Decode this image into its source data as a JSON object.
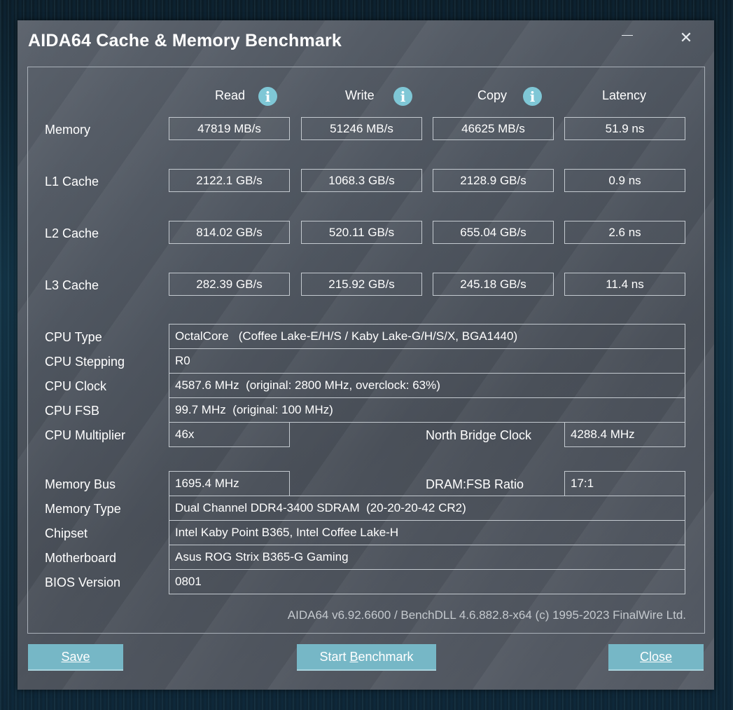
{
  "window": {
    "title": "AIDA64 Cache & Memory Benchmark",
    "close_glyph": "✕"
  },
  "columns": {
    "read": "Read",
    "write": "Write",
    "copy": "Copy",
    "latency": "Latency",
    "info_glyph": "i"
  },
  "bench_rows": [
    {
      "label": "Memory",
      "read": "47819 MB/s",
      "write": "51246 MB/s",
      "copy": "46625 MB/s",
      "latency": "51.9 ns"
    },
    {
      "label": "L1 Cache",
      "read": "2122.1 GB/s",
      "write": "1068.3 GB/s",
      "copy": "2128.9 GB/s",
      "latency": "0.9 ns"
    },
    {
      "label": "L2 Cache",
      "read": "814.02 GB/s",
      "write": "520.11 GB/s",
      "copy": "655.04 GB/s",
      "latency": "2.6 ns"
    },
    {
      "label": "L3 Cache",
      "read": "282.39 GB/s",
      "write": "215.92 GB/s",
      "copy": "245.18 GB/s",
      "latency": "11.4 ns"
    }
  ],
  "cpu": {
    "type_label": "CPU Type",
    "type_value": "OctalCore   (Coffee Lake-E/H/S / Kaby Lake-G/H/S/X, BGA1440)",
    "stepping_label": "CPU Stepping",
    "stepping_value": "R0",
    "clock_label": "CPU Clock",
    "clock_value": "4587.6 MHz  (original: 2800 MHz, overclock: 63%)",
    "fsb_label": "CPU FSB",
    "fsb_value": "99.7 MHz  (original: 100 MHz)",
    "multiplier_label": "CPU Multiplier",
    "multiplier_value": "46x",
    "nb_clock_label": "North Bridge Clock",
    "nb_clock_value": "4288.4 MHz"
  },
  "memory": {
    "bus_label": "Memory Bus",
    "bus_value": "1695.4 MHz",
    "ratio_label": "DRAM:FSB Ratio",
    "ratio_value": "17:1",
    "type_label": "Memory Type",
    "type_value": "Dual Channel DDR4-3400 SDRAM  (20-20-20-42 CR2)"
  },
  "system": {
    "chipset_label": "Chipset",
    "chipset_value": "Intel Kaby Point B365, Intel Coffee Lake-H",
    "motherboard_label": "Motherboard",
    "motherboard_value": "Asus ROG Strix B365-G Gaming",
    "bios_label": "BIOS Version",
    "bios_value": "0801"
  },
  "footer": "AIDA64 v6.92.6600 / BenchDLL 4.6.882.8-x64  (c) 1995-2023 FinalWire Ltd.",
  "buttons": {
    "save": "Save",
    "start_benchmark_pre": "Start ",
    "start_benchmark_underlined": "B",
    "start_benchmark_post": "enchmark",
    "close": "Close"
  }
}
